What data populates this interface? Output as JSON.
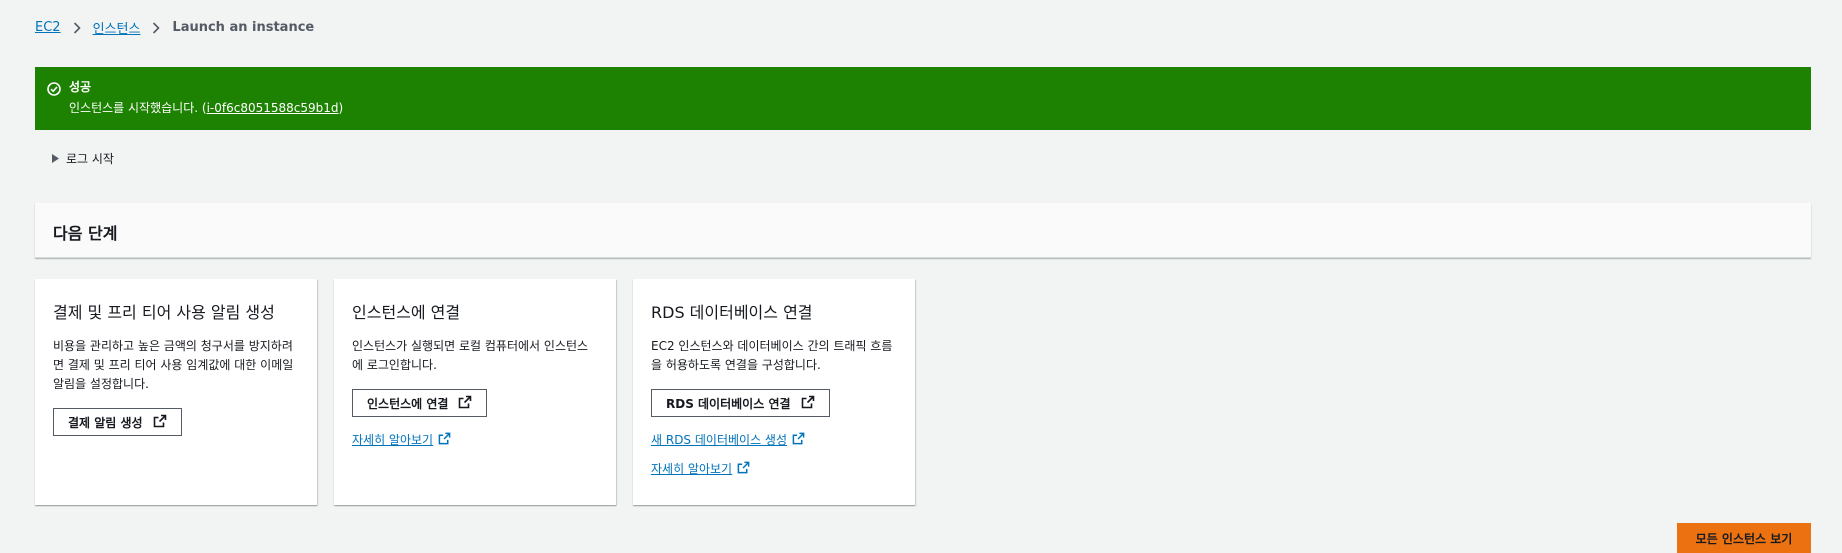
{
  "breadcrumb": {
    "items": [
      "EC2",
      "인스턴스"
    ],
    "current": "Launch an instance"
  },
  "flash": {
    "title": "성공",
    "message_prefix": "인스턴스를 시작했습니다. (",
    "instance_id": "i-0f6c8051588c59b1d",
    "message_suffix": ")",
    "color": "#1d8102"
  },
  "log": {
    "label": "로그 시작"
  },
  "next_steps": {
    "title": "다음 단계"
  },
  "cards": [
    {
      "title": "결제 및 프리 티어 사용 알림 생성",
      "desc": "비용을 관리하고 높은 금액의 청구서를 방지하려면 결제 및 프리 티어 사용 임계값에 대한 이메일 알림을 설정합니다.",
      "button": "결제 알림 생성"
    },
    {
      "title": "인스턴스에 연결",
      "desc": "인스턴스가 실행되면 로컬 컴퓨터에서 인스턴스에 로그인합니다.",
      "button": "인스턴스에 연결",
      "links": [
        "자세히 알아보기"
      ]
    },
    {
      "title": "RDS 데이터베이스 연결",
      "desc": "EC2 인스턴스와 데이터베이스 간의 트래픽 흐름을 허용하도록 연결을 구성합니다.",
      "button": "RDS 데이터베이스 연결",
      "links": [
        "새 RDS 데이터베이스 생성",
        "자세히 알아보기"
      ]
    }
  ],
  "footer": {
    "view_all_label": "모든 인스턴스 보기",
    "accent": "#ec7211"
  }
}
